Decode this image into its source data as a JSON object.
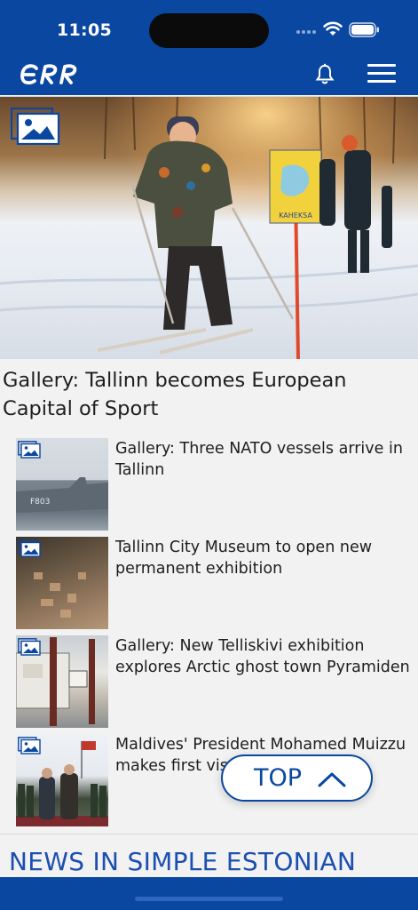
{
  "status_bar": {
    "time": "11:05"
  },
  "header": {
    "logo_text": "ERR",
    "brand_color": "#0a47a1"
  },
  "hero": {
    "sign_text": "KAHEKSA",
    "headline": "Gallery: Tallinn becomes European Capital of Sport"
  },
  "articles": [
    {
      "title": "Gallery: Three NATO vessels arrive in Tallinn",
      "image_text": "F803"
    },
    {
      "title": "Tallinn City Museum to open new permanent exhibition"
    },
    {
      "title": "Gallery: New Telliskivi exhibition explores Arctic ghost town Pyramiden"
    },
    {
      "title": "Maldives' President Mohamed Muizzu makes first vis"
    }
  ],
  "section": {
    "title": "NEWS IN SIMPLE ESTONIAN"
  },
  "scroll_top": {
    "label": "TOP"
  }
}
